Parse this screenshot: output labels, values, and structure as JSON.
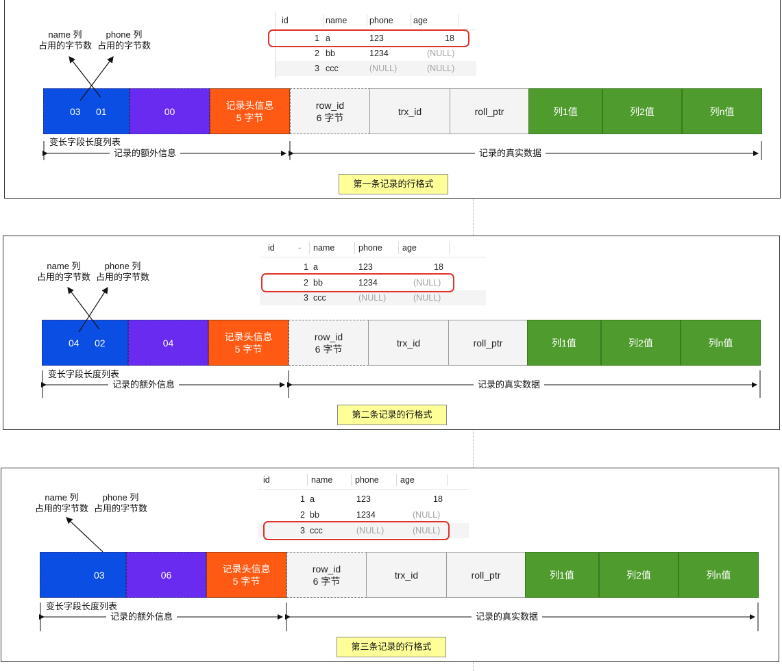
{
  "table": {
    "headers": [
      "id",
      "name",
      "phone",
      "age"
    ],
    "rows": [
      {
        "id": "1",
        "name": "a",
        "phone": "123",
        "age": "18"
      },
      {
        "id": "2",
        "name": "bb",
        "phone": "1234",
        "age": "(NULL)"
      },
      {
        "id": "3",
        "name": "ccc",
        "phone": "(NULL)",
        "age": "(NULL)"
      }
    ]
  },
  "labels": {
    "name_col": "name 列",
    "phone_col": "phone 列",
    "bytes_used": "占用的字节数",
    "varlen_list": "变长字段长度列表",
    "extra_info": "记录的额外信息",
    "real_data": "记录的真实数据",
    "header_info_line1": "记录头信息",
    "header_info_line2": "5 字节",
    "row_id_line1": "row_id",
    "row_id_line2": "6 字节",
    "trx_id": "trx_id",
    "roll_ptr": "roll_ptr",
    "col1": "列1值",
    "col2": "列2值",
    "coln": "列n值"
  },
  "records": [
    {
      "varlen_bytes": [
        "03",
        "01"
      ],
      "null_list": "00",
      "caption": "第一条记录的行格式",
      "highlight_row": 1
    },
    {
      "varlen_bytes": [
        "04",
        "02"
      ],
      "null_list": "04",
      "caption": "第二条记录的行格式",
      "highlight_row": 2
    },
    {
      "varlen_bytes": [
        "03"
      ],
      "null_list": "06",
      "caption": "第三条记录的行格式",
      "highlight_row": 3
    }
  ],
  "colors": {
    "blue": "#0a4ee3",
    "purple": "#6a2bf0",
    "orange": "#ff5a14",
    "green": "#4f9b2d",
    "grey": "#f4f4f4",
    "highlight": "#e0312a",
    "caption_bg": "#ffff99"
  }
}
